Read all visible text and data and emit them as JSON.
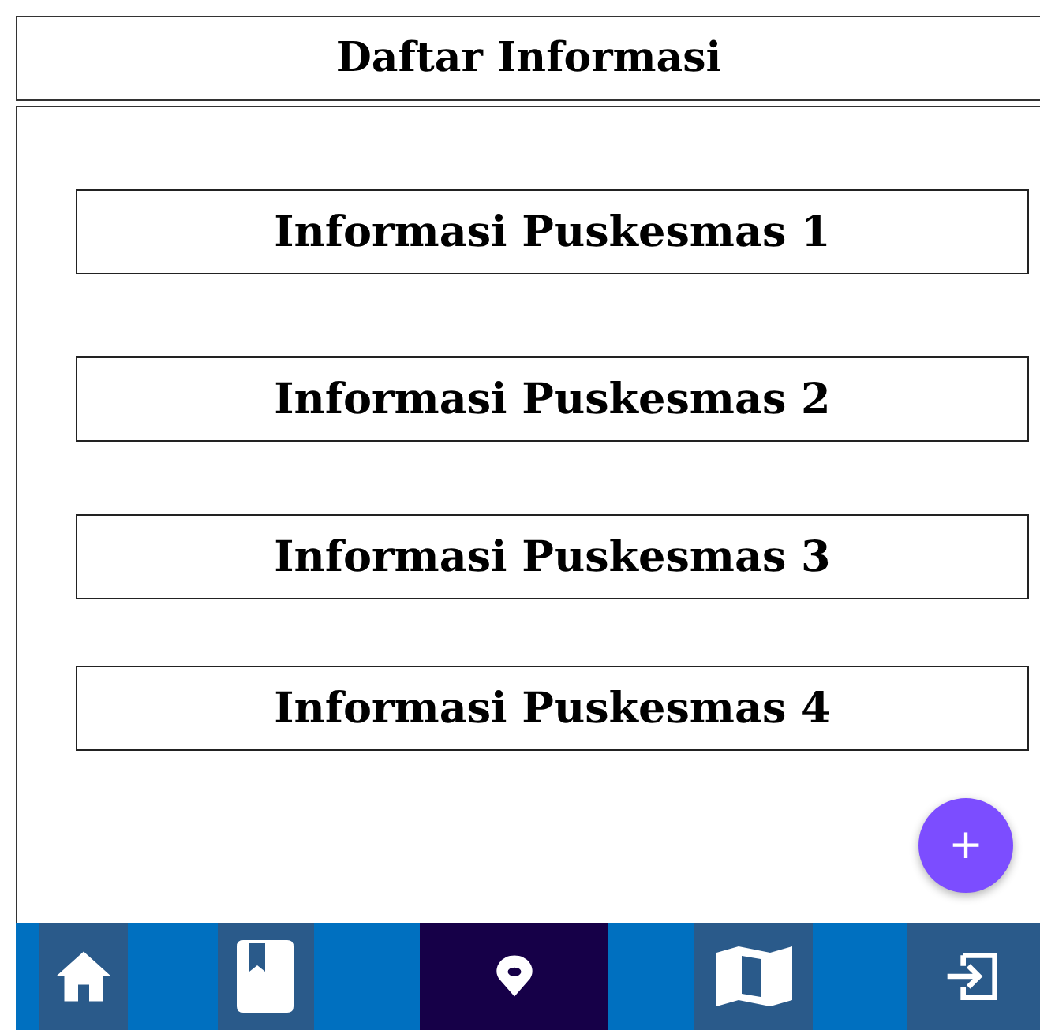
{
  "header": {
    "title": "Daftar Informasi"
  },
  "items": [
    {
      "label": "Informasi Puskesmas 1"
    },
    {
      "label": "Informasi Puskesmas 2"
    },
    {
      "label": "Informasi Puskesmas 3"
    },
    {
      "label": "Informasi Puskesmas 4"
    }
  ],
  "fab": {
    "label": "+"
  },
  "nav": [
    {
      "kind": "home",
      "selected": false
    },
    {
      "kind": "book",
      "selected": false
    },
    {
      "kind": "pin",
      "selected": true
    },
    {
      "kind": "map",
      "selected": false
    },
    {
      "kind": "exit",
      "selected": false
    }
  ]
}
